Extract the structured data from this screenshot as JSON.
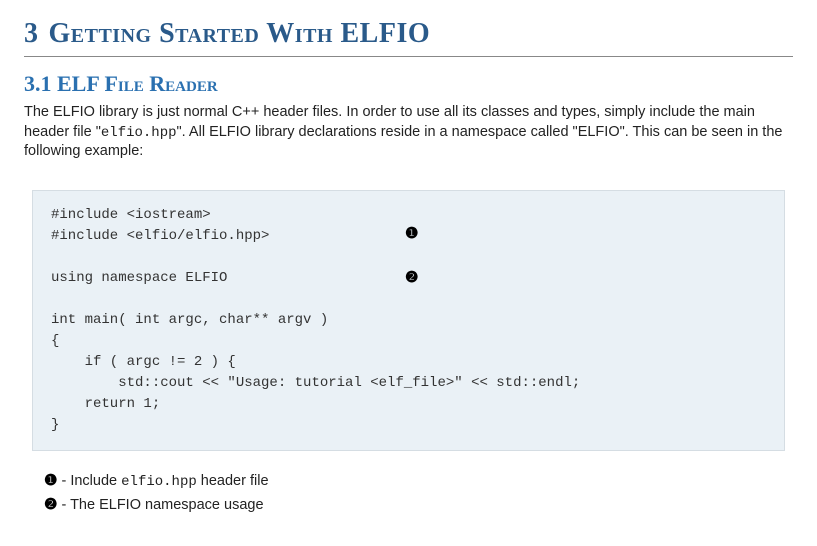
{
  "chapter": {
    "number": "3",
    "title": "Getting Started With ELFIO"
  },
  "section": {
    "number": "3.1",
    "title": "ELF File Reader"
  },
  "paragraph": {
    "part1": "The ELFIO library is just normal C++ header files. In order to use all its classes and types, simply include the main header file \"",
    "code1": "elfio.hpp",
    "part2": "\". All ELFIO library declarations reside in a namespace called \"ELFIO\". This can be seen in the following example:"
  },
  "code": {
    "text": "#include <iostream>\n#include <elfio/elfio.hpp>\n\nusing namespace ELFIO\n\nint main( int argc, char** argv )\n{\n    if ( argc != 2 ) {\n        std::cout << \"Usage: tutorial <elf_file>\" << std::endl;\n    return 1;\n}",
    "marker1": "❶",
    "marker2": "❷"
  },
  "callouts": {
    "c1": {
      "marker": "❶",
      "dash": " - ",
      "pre": "Include ",
      "code": "elfio.hpp",
      "post": " header file"
    },
    "c2": {
      "marker": "❷",
      "dash": " - ",
      "text": "The ELFIO namespace usage"
    }
  }
}
